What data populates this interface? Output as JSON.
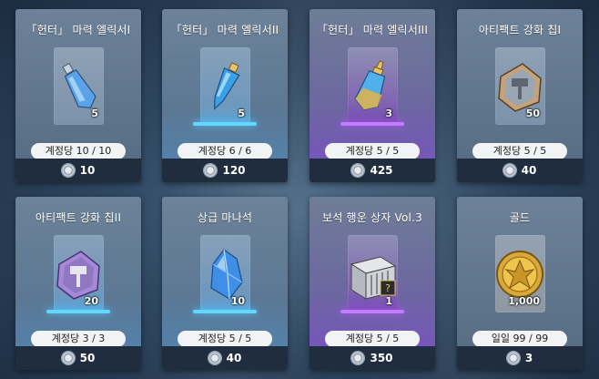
{
  "shop": {
    "currency_icon": "silver-coin-icon",
    "items": [
      {
        "title": "「헌터」 마력 엘릭서I",
        "icon": "elixir-bottle-icon",
        "quantity": "5",
        "limit": "계정당 10 / 10",
        "price": "10",
        "rarity_color": "#7c92aa"
      },
      {
        "title": "「헌터」 마력 엘릭서II",
        "icon": "elixir-bottle-icon",
        "quantity": "5",
        "limit": "계정당 6 / 6",
        "price": "120",
        "rarity_color": "#5aa4d8"
      },
      {
        "title": "「헌터」 마력 엘릭서III",
        "icon": "elixir-bottle-icon",
        "quantity": "3",
        "limit": "계정당 5 / 5",
        "price": "425",
        "rarity_color": "#7348b0"
      },
      {
        "title": "아티팩트 강화 칩I",
        "icon": "hammer-chip-icon",
        "quantity": "50",
        "limit": "계정당 5 / 5",
        "price": "40",
        "rarity_color": "#7c92aa"
      },
      {
        "title": "아티팩트 강화 칩II",
        "icon": "hammer-chip-icon",
        "quantity": "20",
        "limit": "계정당 3 / 3",
        "price": "50",
        "rarity_color": "#5aa4d8"
      },
      {
        "title": "상급 마나석",
        "icon": "mana-crystal-icon",
        "quantity": "10",
        "limit": "계정당 5 / 5",
        "price": "40",
        "rarity_color": "#5aa4d8"
      },
      {
        "title": "보석 행운 상자 Vol.3",
        "icon": "gem-lucky-box-icon",
        "quantity": "1",
        "limit": "계정당 5 / 5",
        "price": "350",
        "rarity_color": "#7348b0"
      },
      {
        "title": "골드",
        "icon": "gold-coin-icon",
        "quantity": "1,000",
        "limit": "일일 99 / 99",
        "price": "3",
        "rarity_color": "#8e98a2"
      }
    ]
  }
}
